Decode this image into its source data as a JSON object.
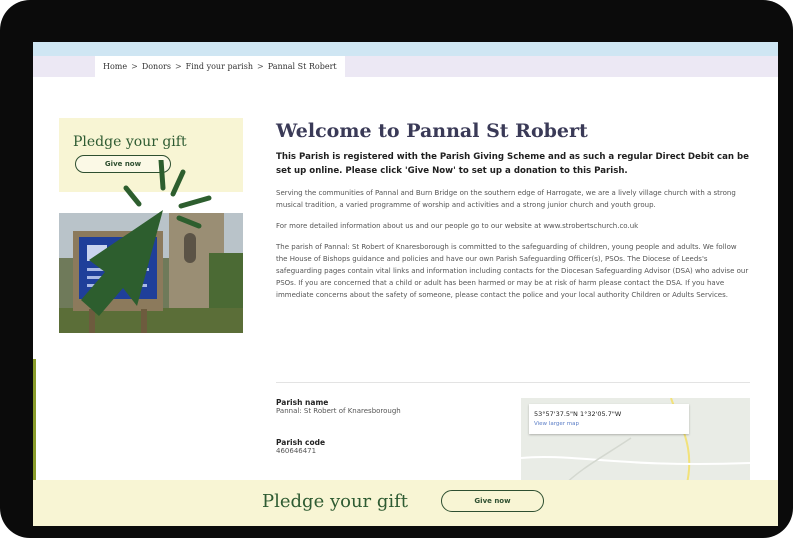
{
  "breadcrumb": {
    "items": [
      "Home",
      "Donors",
      "Find your parish",
      "Pannal St Robert"
    ],
    "separator": ">"
  },
  "sidebar": {
    "pledge_title": "Pledge your gift",
    "give_now_label": "Give now"
  },
  "main": {
    "title": "Welcome to Pannal St Robert",
    "intro": "This Parish is registered with the Parish Giving Scheme and as such a regular Direct Debit can be set up online. Please click 'Give Now' to set up a donation to this Parish.",
    "paragraphs": [
      "Serving the communities of Pannal and Burn Bridge on the southern edge of Harrogate, we are a lively village church with a strong musical tradition, a varied programme of worship and activities and a strong junior church and youth group.",
      "For more detailed information about us and our people go to our website at www.strobertschurch.co.uk",
      "The parish of Pannal: St Robert of Knaresborough is committed to the safeguarding of children, young people and adults. We follow the House of Bishops guidance and policies and have our own Parish Safeguarding Officer(s), PSOs. The Diocese of Leeds's safeguarding pages contain vital links and information including contacts for the Diocesan Safeguarding Advisor (DSA) who advise our PSOs. If you are concerned that a child or adult has been harmed or may be at risk of harm please contact the DSA. If you have immediate concerns about the safety of someone, please contact the police and your local authority Children or Adults Services."
    ]
  },
  "details": {
    "parish_name_label": "Parish name",
    "parish_name": "Pannal: St Robert of Knaresborough",
    "parish_code_label": "Parish code",
    "parish_code": "460646471"
  },
  "map": {
    "coordinates": "53°57'37.5\"N 1°32'05.7\"W",
    "link": "View larger map"
  },
  "footer": {
    "pledge_title": "Pledge your gift",
    "give_now_label": "Give now"
  },
  "colors": {
    "brand_green": "#2e5b32",
    "pledge_bg": "#f8f5d4",
    "accent_olive": "#8a9d2b"
  }
}
